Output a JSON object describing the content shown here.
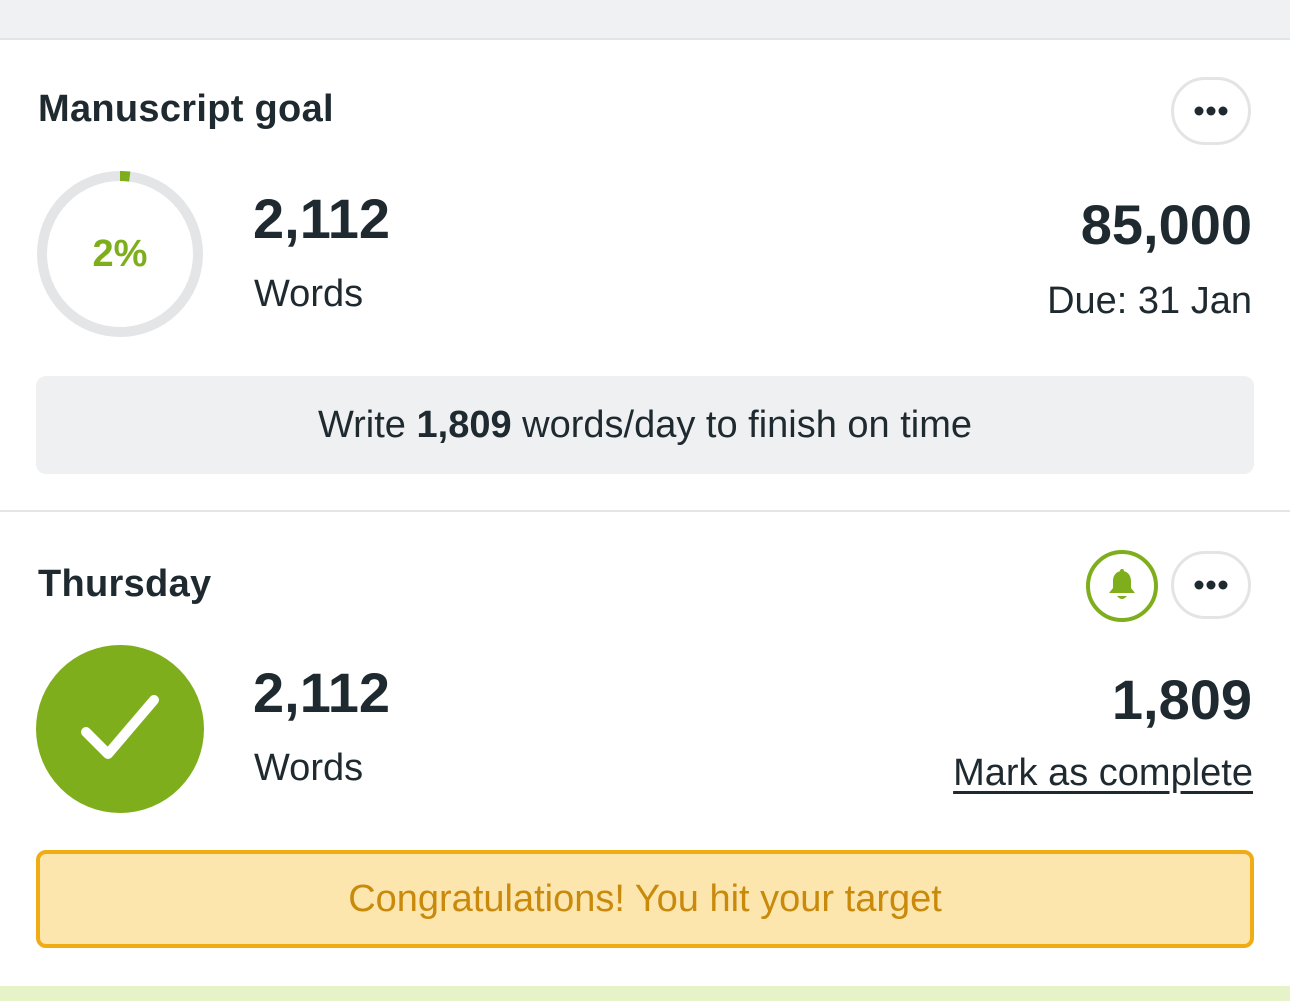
{
  "manuscript": {
    "title": "Manuscript goal",
    "progress_percent_label": "2%",
    "progress_fraction": 0.02,
    "words_count": "2,112",
    "words_label": "Words",
    "target_count": "85,000",
    "due_label": "Due: 31 Jan",
    "pace": {
      "prefix": "Write ",
      "amount": "1,809",
      "suffix": " words/day to finish on time"
    }
  },
  "daily": {
    "title": "Thursday",
    "words_count": "2,112",
    "words_label": "Words",
    "target_count": "1,809",
    "mark_complete_label": "Mark as complete",
    "congrats_message": "Congratulations! You hit your target"
  },
  "colors": {
    "accent_green": "#7fae1c",
    "warning_border": "#f0ac14",
    "warning_bg": "#fde6ad",
    "warning_text": "#c98a0c",
    "text_dark": "#1f2a30"
  },
  "icons": {
    "more": "more-horizontal-icon",
    "reminder": "bell-icon",
    "complete": "checkmark-icon"
  }
}
